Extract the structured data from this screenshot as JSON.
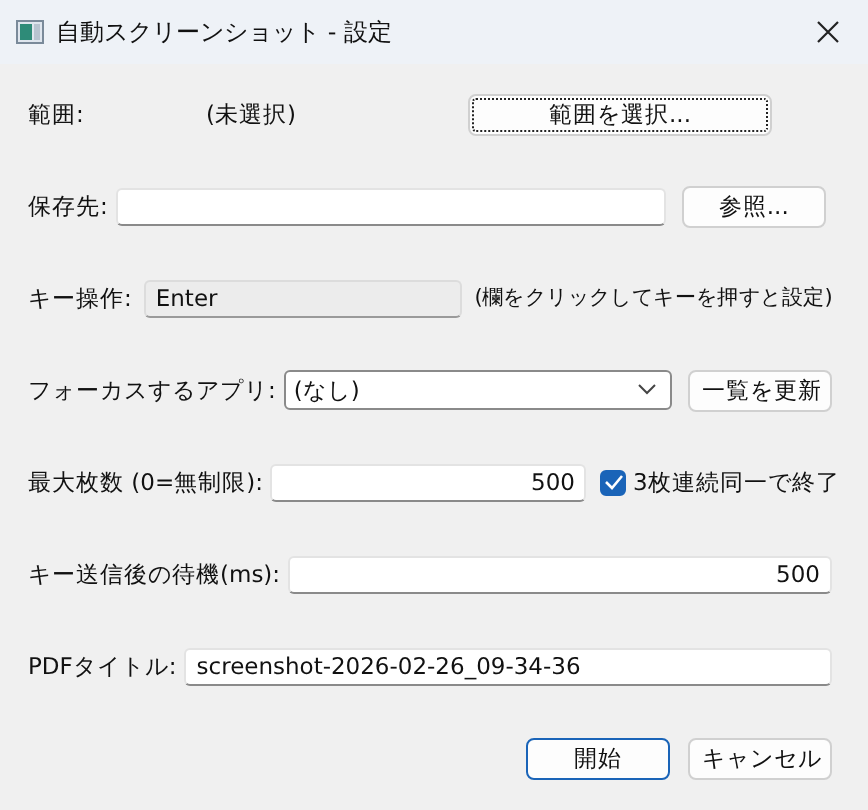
{
  "window": {
    "title": "自動スクリーンショット - 設定"
  },
  "range": {
    "label": "範囲:",
    "value": "(未選択)",
    "button": {
      "label": "範囲を選択...",
      "focused": true
    }
  },
  "save_to": {
    "label": "保存先:",
    "button": {
      "label": "参照...",
      "focused": false
    }
  },
  "key": {
    "label": "キー操作:",
    "value": "Enter",
    "readonly": true,
    "hint": "(欄をクリックしてキーを押すと設定)"
  },
  "focus_app": {
    "label": "フォーカスするアプリ:",
    "value": "(なし)",
    "button": {
      "label": "一覧を更新",
      "focused": false
    }
  },
  "max_count": {
    "label": "最大枚数 (0=無制限):",
    "value": "500",
    "checkbox": {
      "label": "3枚連続同一で終了",
      "checked": true
    }
  },
  "wait": {
    "label": "キー送信後の待機(ms):",
    "value": "500"
  },
  "pdf_title": {
    "label": "PDFタイトル:",
    "value": "screenshot-2026-02-26_09-34-36"
  },
  "buttons": [
    {
      "label": "開始",
      "default": true
    },
    {
      "label": "キャンセル",
      "default": false
    }
  ]
}
